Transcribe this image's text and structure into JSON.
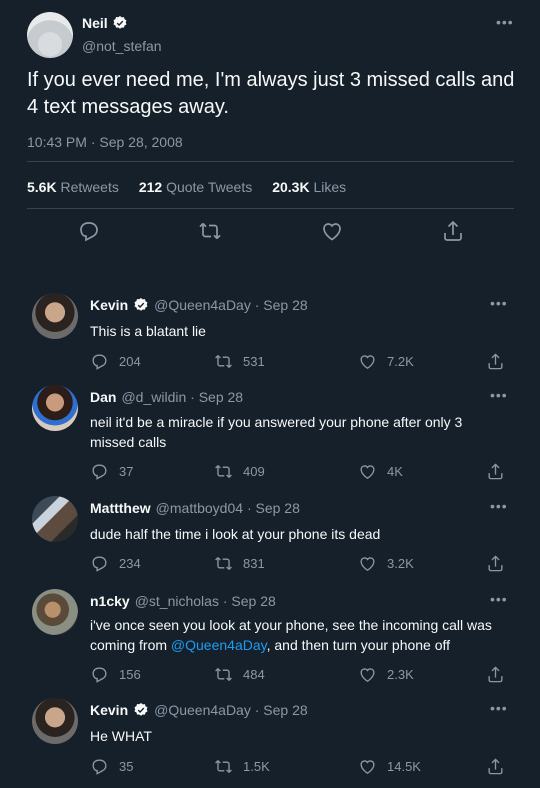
{
  "main_tweet": {
    "name": "Neil",
    "handle": "@not_stefan",
    "text": "If you ever need me, I'm always just 3 missed calls and 4 text messages away.",
    "timestamp": "10:43 PM · Sep 28, 2008",
    "retweets_count": "5.6K",
    "retweets_label": "Retweets",
    "quote_count": "212",
    "quote_label": "Quote Tweets",
    "likes_count": "20.3K",
    "likes_label": "Likes"
  },
  "replies": [
    {
      "name": "Kevin",
      "verified": true,
      "handle": "@Queen4aDay",
      "date": "· Sep 28",
      "text": "This is a blatant lie",
      "replies": "204",
      "retweets": "531",
      "likes": "7.2K"
    },
    {
      "name": "Dan",
      "verified": false,
      "handle": "@d_wildin",
      "date": "· Sep 28",
      "text": "neil it'd be a miracle if you answered your phone after only 3 missed calls",
      "replies": "37",
      "retweets": "409",
      "likes": "4K"
    },
    {
      "name": "Mattthew",
      "verified": false,
      "handle": "@mattboyd04",
      "date": "· Sep 28",
      "text": "dude half the time i look at your phone its dead",
      "replies": "234",
      "retweets": "831",
      "likes": "3.2K"
    },
    {
      "name": "n1cky",
      "verified": false,
      "handle": "@st_nicholas",
      "date": "· Sep 28",
      "text_before": "i've once seen you look at your phone, see the incoming call was coming from ",
      "text_mention": "@Queen4aDay",
      "text_after": ", and then turn your phone off",
      "replies": "156",
      "retweets": "484",
      "likes": "2.3K"
    },
    {
      "name": "Kevin",
      "verified": true,
      "handle": "@Queen4aDay",
      "date": "· Sep 28",
      "text": "He WHAT",
      "replies": "35",
      "retweets": "1.5K",
      "likes": "14.5K"
    }
  ],
  "icons": [
    "verified-badge-icon",
    "more-icon",
    "reply-icon",
    "retweet-icon",
    "like-icon",
    "share-icon"
  ],
  "colors": {
    "background": "#15202b",
    "text": "#f7f9f9",
    "muted": "#8b98a5",
    "accent": "#1d9bf0",
    "divider": "#38444d"
  }
}
